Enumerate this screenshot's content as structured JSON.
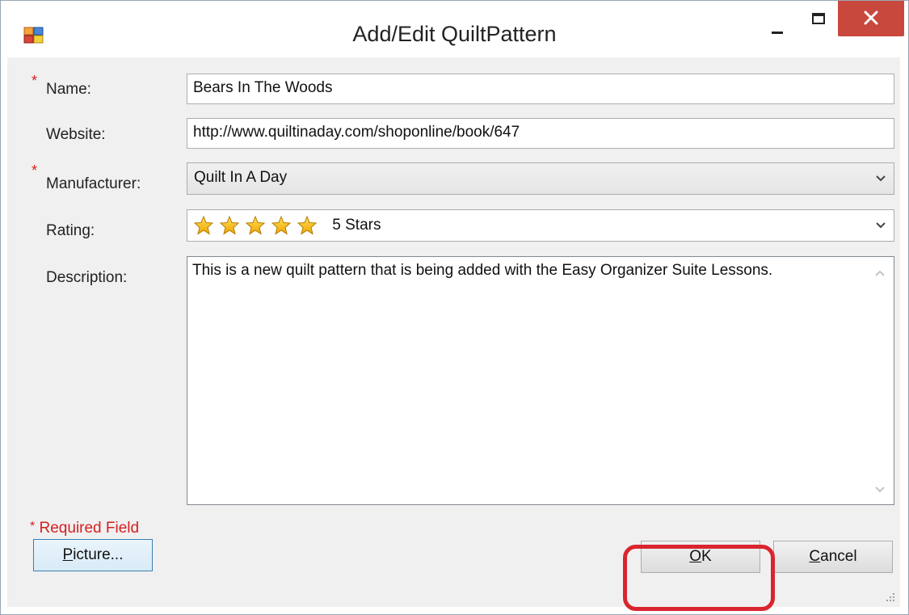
{
  "window": {
    "title": "Add/Edit QuiltPattern",
    "icon": "app-icon",
    "controls": {
      "minimize": "minimize-icon",
      "maximize": "maximize-icon",
      "close": "close-icon"
    }
  },
  "form": {
    "name": {
      "label": "Name:",
      "value": "Bears In The Woods",
      "required": true
    },
    "website": {
      "label": "Website:",
      "value": "http://www.quiltinaday.com/shoponline/book/647",
      "required": false
    },
    "manufacturer": {
      "label": "Manufacturer:",
      "value": "Quilt In A Day",
      "required": true
    },
    "rating": {
      "label": "Rating:",
      "value": "5 Stars",
      "stars": 5
    },
    "description": {
      "label": "Description:",
      "value": "This is a new quilt pattern that is being added with the Easy Organizer Suite Lessons."
    }
  },
  "required_note": {
    "star": "*",
    "text": "Required Field"
  },
  "buttons": {
    "picture": {
      "mnemonic": "P",
      "rest": "icture..."
    },
    "ok": {
      "mnemonic": "O",
      "rest": "K"
    },
    "cancel": {
      "mnemonic": "C",
      "rest": "ancel"
    }
  },
  "colors": {
    "required": "#d62020",
    "close_button": "#c9483e",
    "highlight": "#d9252f"
  }
}
